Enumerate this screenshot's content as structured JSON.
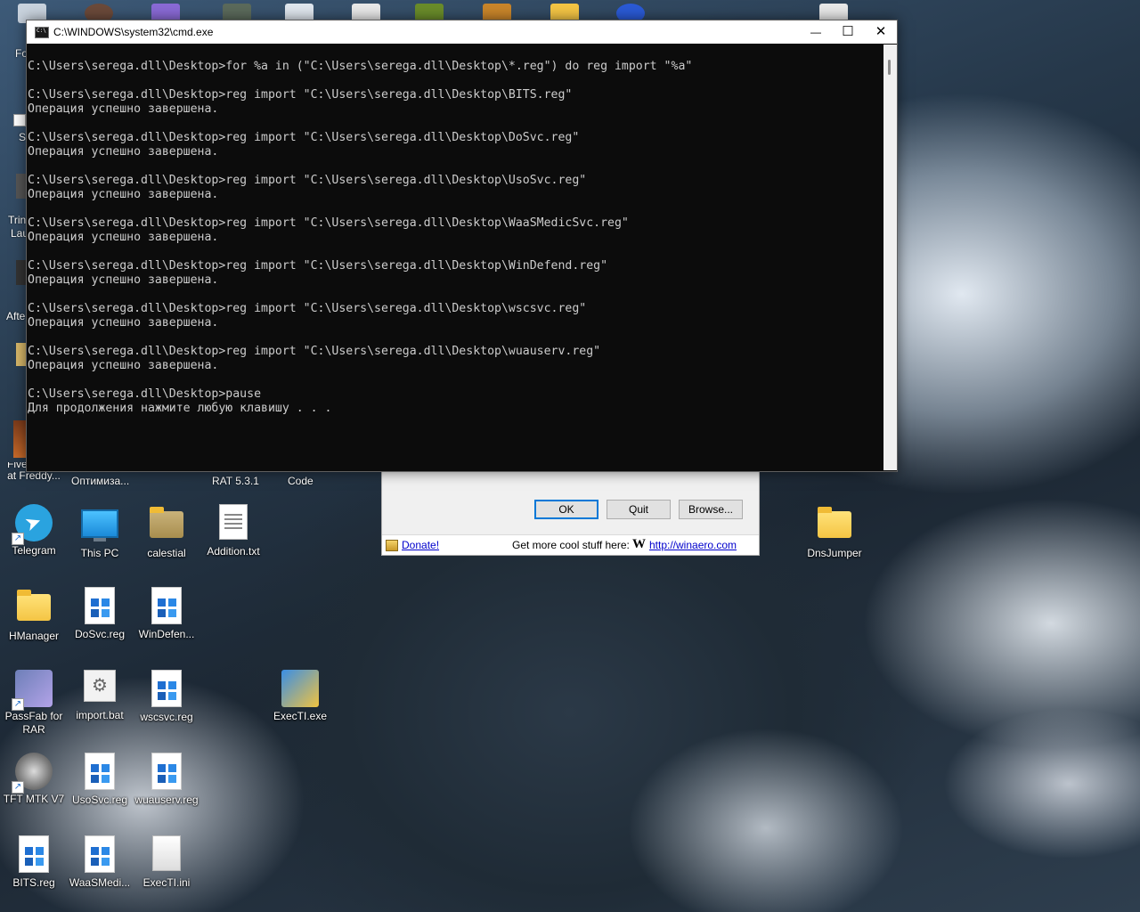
{
  "cmd": {
    "title": "C:\\WINDOWS\\system32\\cmd.exe",
    "lines": [
      "C:\\Users\\serega.dll\\Desktop>for %a in (\"C:\\Users\\serega.dll\\Desktop\\*.reg\") do reg import \"%a\"",
      "",
      "C:\\Users\\serega.dll\\Desktop>reg import \"C:\\Users\\serega.dll\\Desktop\\BITS.reg\"",
      "Операция успешно завершена.",
      "",
      "C:\\Users\\serega.dll\\Desktop>reg import \"C:\\Users\\serega.dll\\Desktop\\DoSvc.reg\"",
      "Операция успешно завершена.",
      "",
      "C:\\Users\\serega.dll\\Desktop>reg import \"C:\\Users\\serega.dll\\Desktop\\UsoSvc.reg\"",
      "Операция успешно завершена.",
      "",
      "C:\\Users\\serega.dll\\Desktop>reg import \"C:\\Users\\serega.dll\\Desktop\\WaaSMedicSvc.reg\"",
      "Операция успешно завершена.",
      "",
      "C:\\Users\\serega.dll\\Desktop>reg import \"C:\\Users\\serega.dll\\Desktop\\WinDefend.reg\"",
      "Операция успешно завершена.",
      "",
      "C:\\Users\\serega.dll\\Desktop>reg import \"C:\\Users\\serega.dll\\Desktop\\wscsvc.reg\"",
      "Операция успешно завершена.",
      "",
      "C:\\Users\\serega.dll\\Desktop>reg import \"C:\\Users\\serega.dll\\Desktop\\wuauserv.reg\"",
      "Операция успешно завершена.",
      "",
      "C:\\Users\\serega.dll\\Desktop>pause",
      "Для продолжения нажмите любую клавишу . . ."
    ],
    "minimize_glyph": "—",
    "maximize_glyph": "☐",
    "close_glyph": "✕"
  },
  "winaero": {
    "ok_label": "OK",
    "quit_label": "Quit",
    "browse_label": "Browse...",
    "donate_label": "Donate!",
    "cool_stuff_text": "Get more cool stuff here:",
    "logo_letter": "W",
    "site_link": "http://winaero.com"
  },
  "desktop": {
    "partial_labels": {
      "fo": "Fo",
      "s": "S",
      "trin": "Trin",
      "lau": "Lau",
      "afte": "Afte",
      "five_line1": "Five Nights",
      "five_line2": "at Freddy...",
      "optimiz": "Оптимиза...",
      "rat": "RAT 5.3.1",
      "code": "Code"
    },
    "icons": [
      {
        "label": "Telegram",
        "icon": "telegram-icon"
      },
      {
        "label": "This PC",
        "icon": "this-pc-icon"
      },
      {
        "label": "calestial",
        "icon": "folder-icon"
      },
      {
        "label": "Addition.txt",
        "icon": "text-file-icon"
      },
      {
        "label": "DnsJumper",
        "icon": "folder-icon"
      },
      {
        "label": "HManager",
        "icon": "folder-icon"
      },
      {
        "label": "DoSvc.reg",
        "icon": "registry-file-icon"
      },
      {
        "label": "WinDefen...",
        "icon": "registry-file-icon"
      },
      {
        "label": "PassFab for",
        "label2": "RAR",
        "icon": "passfab-icon"
      },
      {
        "label": "import.bat",
        "icon": "batch-file-icon"
      },
      {
        "label": "wscsvc.reg",
        "icon": "registry-file-icon"
      },
      {
        "label": "ExecTI.exe",
        "icon": "exec-ti-icon"
      },
      {
        "label": "TFT MTK V7",
        "icon": "tft-mtk-icon"
      },
      {
        "label": "UsoSvc.reg",
        "icon": "registry-file-icon"
      },
      {
        "label": "wuauserv.reg",
        "icon": "registry-file-icon"
      },
      {
        "label": "BITS.reg",
        "icon": "registry-file-icon"
      },
      {
        "label": "WaaSMedi...",
        "icon": "registry-file-icon"
      },
      {
        "label": "ExecTI.ini",
        "icon": "ini-file-icon"
      }
    ]
  }
}
